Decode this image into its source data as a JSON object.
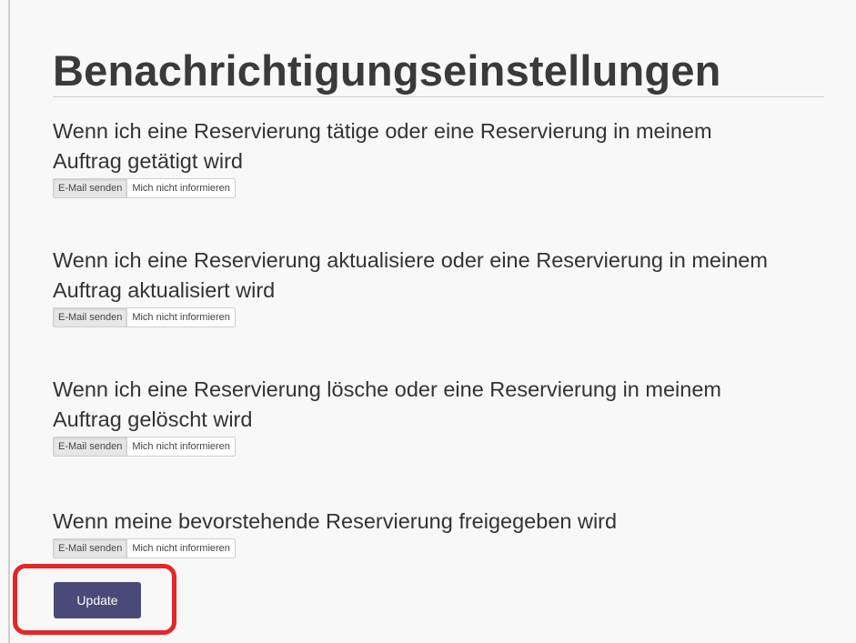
{
  "page": {
    "title": "Benachrichtigungseinstellungen"
  },
  "settings": [
    {
      "label": "Wenn ich eine Reservierung tätige oder eine Reservierung in meinem Auftrag getätigt wird",
      "options": [
        "E-Mail senden",
        "Mich nicht informieren"
      ],
      "selected": "E-Mail senden"
    },
    {
      "label": "Wenn ich eine Reservierung aktualisiere oder eine Reservierung in meinem Auftrag aktualisiert wird",
      "options": [
        "E-Mail senden",
        "Mich nicht informieren"
      ],
      "selected": "E-Mail senden"
    },
    {
      "label": "Wenn ich eine Reservierung lösche oder eine Reservierung in meinem Auftrag gelöscht wird",
      "options": [
        "E-Mail senden",
        "Mich nicht informieren"
      ],
      "selected": "E-Mail senden"
    },
    {
      "label": "Wenn meine bevorstehende Reservierung freigegeben wird",
      "options": [
        "E-Mail senden",
        "Mich nicht informieren"
      ],
      "selected": "E-Mail senden"
    }
  ],
  "actions": {
    "update_label": "Update"
  },
  "colors": {
    "update_button": "#4a4a78",
    "highlight": "#e32626"
  }
}
